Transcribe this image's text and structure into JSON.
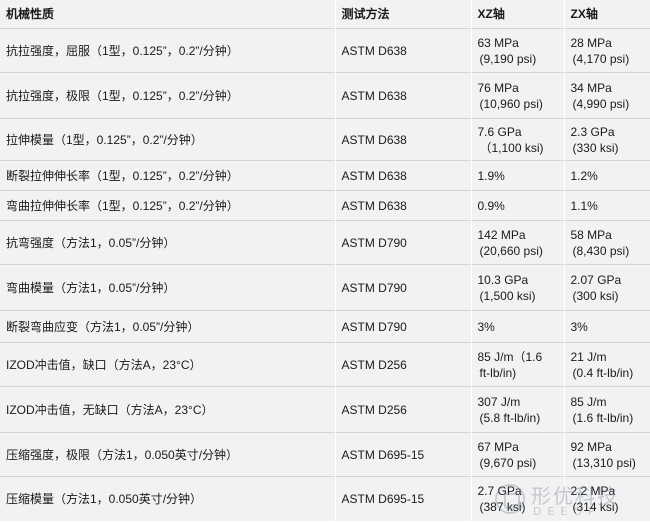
{
  "header": {
    "property": "机械性质",
    "method": "测试方法",
    "xz": "XZ轴",
    "zx": "ZX轴"
  },
  "rows": [
    {
      "property": "抗拉强度，屈服（1型，0.125”，0.2”/分钟）",
      "method": "ASTM D638",
      "xz_value": "63 MPa",
      "xz_sub": "(9,190 psi)",
      "zx_value": "28 MPa",
      "zx_sub": "(4,170 psi)"
    },
    {
      "property": "抗拉强度，极限（1型，0.125”，0.2”/分钟）",
      "method": "ASTM D638",
      "xz_value": "76 MPa",
      "xz_sub": "(10,960 psi)",
      "zx_value": "34 MPa",
      "zx_sub": "(4,990 psi)"
    },
    {
      "property": "拉伸模量（1型，0.125”，0.2”/分钟）",
      "method": "ASTM D638",
      "xz_value": "7.6 GPa",
      "xz_sub": "（1,100 ksi)",
      "zx_value": "2.3 GPa",
      "zx_sub": "(330 ksi)"
    },
    {
      "property": "断裂拉伸伸长率（1型，0.125”，0.2”/分钟）",
      "method": "ASTM D638",
      "xz_value": "1.9%",
      "xz_sub": "",
      "zx_value": "1.2%",
      "zx_sub": ""
    },
    {
      "property": "弯曲拉伸伸长率（1型，0.125”，0.2”/分钟）",
      "method": "ASTM D638",
      "xz_value": "0.9%",
      "xz_sub": "",
      "zx_value": "1.1%",
      "zx_sub": ""
    },
    {
      "property": "抗弯强度（方法1，0.05”/分钟）",
      "method": "ASTM D790",
      "xz_value": "142 MPa",
      "xz_sub": "(20,660 psi)",
      "zx_value": "58 MPa",
      "zx_sub": "(8,430 psi)"
    },
    {
      "property": "弯曲模量（方法1，0.05”/分钟）",
      "method": "ASTM D790",
      "xz_value": "10.3 GPa",
      "xz_sub": "(1,500 ksi)",
      "zx_value": "2.07 GPa",
      "zx_sub": "(300 ksi)"
    },
    {
      "property": "断裂弯曲应变（方法1，0.05”/分钟）",
      "method": "ASTM D790",
      "xz_value": "3%",
      "xz_sub": "",
      "zx_value": "3%",
      "zx_sub": ""
    },
    {
      "property": "IZOD冲击值，缺口（方法A，23°C）",
      "method": "ASTM D256",
      "xz_value": "85 J/m（1.6",
      "xz_sub": "ft-lb/in)",
      "zx_value": "21 J/m",
      "zx_sub": "(0.4 ft-lb/in)"
    },
    {
      "property": "IZOD冲击值，无缺口（方法A，23°C）",
      "method": "ASTM D256",
      "xz_value": "307 J/m",
      "xz_sub": "(5.8 ft-lb/in)",
      "zx_value": "85 J/m",
      "zx_sub": "(1.6 ft-lb/in)"
    },
    {
      "property": "压缩强度，极限（方法1，0.050英寸/分钟）",
      "method": "ASTM D695-15",
      "xz_value": "67 MPa",
      "xz_sub": "(9,670 psi)",
      "zx_value": "92 MPa",
      "zx_sub": "(13,310 psi)"
    },
    {
      "property": "压缩模量（方法1，0.050英寸/分钟）",
      "method": "ASTM D695-15",
      "xz_value": "2.7 GPa",
      "xz_sub": "(387 ksi)",
      "zx_value": "2.2 MPa",
      "zx_sub": "(314 ksi)"
    }
  ],
  "watermark": {
    "text": "形优科技",
    "sub": "DEEOP"
  }
}
